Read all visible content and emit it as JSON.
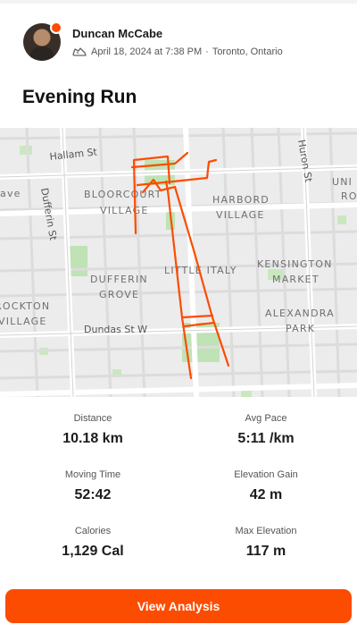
{
  "athlete": {
    "name": "Duncan McCabe"
  },
  "activity": {
    "date_time": "April 18, 2024 at 7:38 PM",
    "location": "Toronto, Ontario",
    "separator": "·",
    "title": "Evening Run",
    "type_icon": "shoe-icon"
  },
  "map": {
    "street_labels": {
      "hallam": "Hallam St",
      "huron": "Huron St",
      "dufferin_st": "Dufferin St",
      "dundas": "Dundas St W"
    },
    "area_labels": {
      "bloorcourt_1": "BLOORCOURT",
      "bloorcourt_2": "VILLAGE",
      "harbord_1": "HARBORD",
      "harbord_2": "VILLAGE",
      "dufferin_grove_1": "DUFFERIN",
      "dufferin_grove_2": "GROVE",
      "little_italy": "LITTLE ITALY",
      "kensington_1": "KENSINGTON",
      "kensington_2": "MARKET",
      "rockton_1": "ROCKTON",
      "rockton_2": "VILLAGE",
      "alexandra_1": "ALEXANDRA",
      "alexandra_2": "PARK",
      "ave": "ave",
      "univ_1": "UNI",
      "univ_2": "RO"
    },
    "route_color": "#fc4c02"
  },
  "stats": {
    "distance": {
      "label": "Distance",
      "value": "10.18 km"
    },
    "avg_pace": {
      "label": "Avg Pace",
      "value": "5:11 /km"
    },
    "moving_time": {
      "label": "Moving Time",
      "value": "52:42"
    },
    "elevation_gain": {
      "label": "Elevation Gain",
      "value": "42 m"
    },
    "calories": {
      "label": "Calories",
      "value": "1,129 Cal"
    },
    "max_elevation": {
      "label": "Max Elevation",
      "value": "117 m"
    }
  },
  "cta": {
    "label": "View Analysis"
  },
  "colors": {
    "brand": "#fc4c02"
  }
}
